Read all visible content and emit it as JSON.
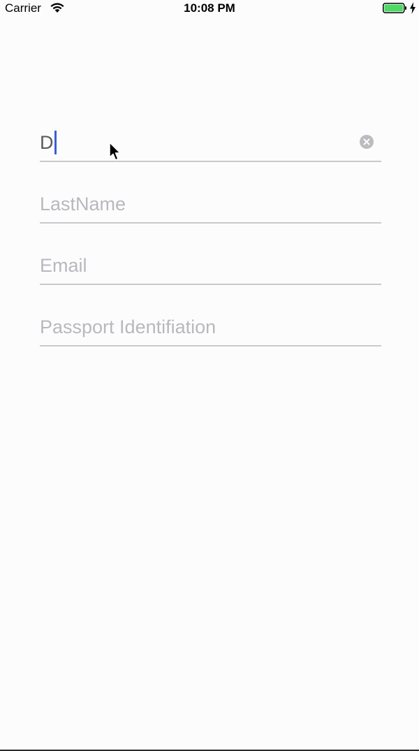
{
  "status_bar": {
    "carrier": "Carrier",
    "time": "10:08 PM",
    "battery_color": "#4cd964"
  },
  "form": {
    "first_name": {
      "value": "D",
      "clear_icon": "clear-circle-icon"
    },
    "last_name": {
      "placeholder": "LastName"
    },
    "email": {
      "placeholder": "Email"
    },
    "passport": {
      "placeholder": "Passport Identifiation"
    }
  },
  "colors": {
    "caret": "#3b5ed3",
    "underline": "#c9c8cc",
    "placeholder": "#b8b8bd"
  }
}
